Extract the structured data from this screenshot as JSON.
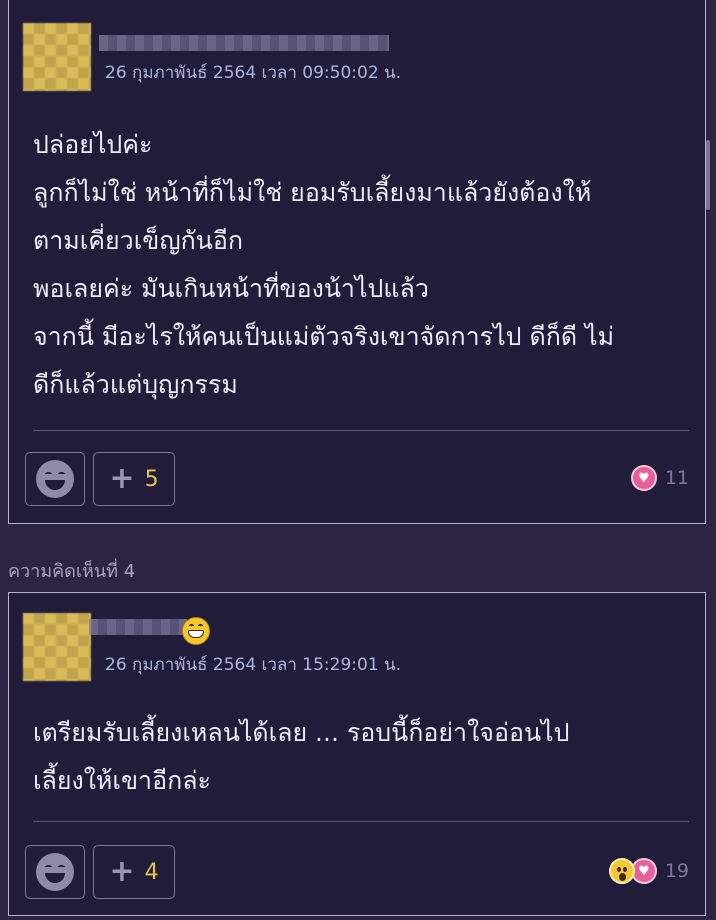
{
  "comment3": {
    "date": "26 กุมภาพันธ์ 2564 เวลา 09:50:02 น.",
    "lines": [
      "ปล่อยไปค่ะ",
      "ลูกก็ไม่ใช่ หน้าที่ก็ไม่ใช่ ยอมรับเลี้ยงมาแล้วยังต้องให้",
      "ตามเคี่ยวเข็ญกันอีก",
      "พอเลยค่ะ มันเกินหน้าที่ของน้าไปแล้ว",
      "จากนี้ มีอะไรให้คนเป็นแม่ตัวจริงเขาจัดการไป ดีก็ดี ไม่",
      "ดีก็แล้วแต่บุญกรรม"
    ],
    "vote_count": "5",
    "reaction_count": "11",
    "reaction_icons": [
      "heart-icon"
    ]
  },
  "comment4": {
    "section_label": "ความคิดเห็นที่ 4",
    "date": "26 กุมภาพันธ์ 2564 เวลา 15:29:01 น.",
    "lines": [
      "เตรียมรับเลี้ยงเหลนได้เลย ... รอบนี้ก็อย่าใจอ่อนไป",
      "เลี้ยงให้เขาอีกล่ะ"
    ],
    "vote_count": "4",
    "reaction_count": "19",
    "reaction_icons": [
      "wow-icon",
      "heart-icon"
    ]
  },
  "icons": {
    "plus": "+",
    "heart": "♥"
  },
  "colors": {
    "background": "#2b2445",
    "card": "#221c3b",
    "vote_count": "#e7c447",
    "date_text": "#a9b6df",
    "heart": "#e8609b"
  }
}
